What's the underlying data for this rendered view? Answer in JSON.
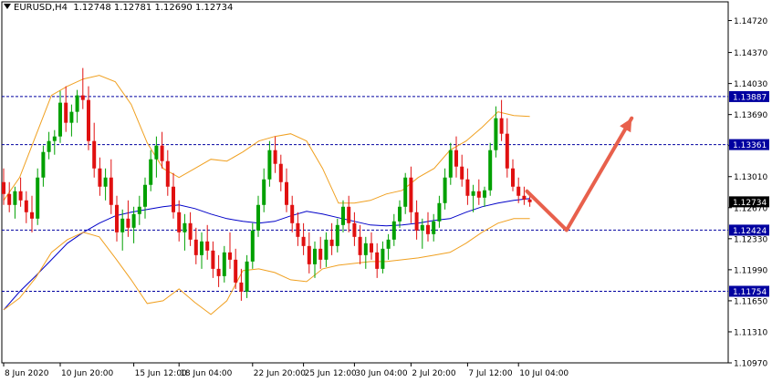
{
  "header": {
    "symbol": "EURUSD,H4",
    "ohlc": "1.12748 1.12781 1.12690 1.12734"
  },
  "chart_data": {
    "type": "candlestick",
    "ylim": [
      1.1097,
      1.14925
    ],
    "y_ticks": [
      "1.14720",
      "1.14370",
      "1.14030",
      "1.13690",
      "1.13350",
      "1.13010",
      "1.12670",
      "1.12330",
      "1.11990",
      "1.11650",
      "1.11310",
      "1.10970"
    ],
    "x_ticks": [
      "8 Jun 2020",
      "10 Jun 20:00",
      "15 Jun 12:00",
      "18 Jun 04:00",
      "22 Jun 20:00",
      "25 Jun 12:00",
      "30 Jun 04:00",
      "2 Jul 20:00",
      "7 Jul 12:00",
      "10 Jul 04:00"
    ],
    "levels": [
      {
        "value": 1.13887,
        "label": "1.13887"
      },
      {
        "value": 1.13361,
        "label": "1.13361"
      },
      {
        "value": 1.12424,
        "label": "1.12424"
      },
      {
        "value": 1.11754,
        "label": "1.11754"
      }
    ],
    "current_price": {
      "value": 1.12734,
      "label": "1.12734"
    },
    "series": [
      {
        "indicator": "moving-average",
        "values": [
          1.1155,
          1.1175,
          1.1192,
          1.121,
          1.1228,
          1.124,
          1.125,
          1.1258,
          1.1262,
          1.1265,
          1.1268,
          1.127,
          1.1266,
          1.126,
          1.1255,
          1.1252,
          1.125,
          1.1252,
          1.1258,
          1.1263,
          1.126,
          1.1256,
          1.1252,
          1.1248,
          1.1247,
          1.1248,
          1.125,
          1.1253,
          1.1255,
          1.1262,
          1.1268,
          1.1272,
          1.1275,
          1.1277
        ]
      },
      {
        "indicator": "bollinger-upper",
        "values": [
          1.1275,
          1.13,
          1.1345,
          1.139,
          1.14,
          1.1408,
          1.1412,
          1.1405,
          1.138,
          1.1338,
          1.131,
          1.13,
          1.131,
          1.132,
          1.1318,
          1.1328,
          1.134,
          1.1345,
          1.1348,
          1.134,
          1.131,
          1.1272,
          1.1272,
          1.1275,
          1.1282,
          1.1286,
          1.13,
          1.131,
          1.133,
          1.134,
          1.1355,
          1.1372,
          1.1368,
          1.1367
        ]
      },
      {
        "indicator": "bollinger-lower",
        "values": [
          1.1155,
          1.1168,
          1.119,
          1.1218,
          1.1232,
          1.124,
          1.1235,
          1.1212,
          1.1188,
          1.1162,
          1.1165,
          1.1178,
          1.1163,
          1.115,
          1.1165,
          1.1198,
          1.12,
          1.1196,
          1.1188,
          1.1186,
          1.12,
          1.1204,
          1.1206,
          1.1208,
          1.1208,
          1.121,
          1.1212,
          1.1215,
          1.1218,
          1.1228,
          1.124,
          1.125,
          1.1255,
          1.1255
        ]
      },
      {
        "name": "EURUSD,H4",
        "ohlc": [
          [
            1.1295,
            1.131,
            1.127,
            1.1282
          ],
          [
            1.1282,
            1.1295,
            1.1262,
            1.127
          ],
          [
            1.127,
            1.129,
            1.1255,
            1.1285
          ],
          [
            1.1285,
            1.13,
            1.1268,
            1.1275
          ],
          [
            1.1275,
            1.1285,
            1.125,
            1.1262
          ],
          [
            1.1262,
            1.128,
            1.124,
            1.1255
          ],
          [
            1.1255,
            1.131,
            1.1248,
            1.13
          ],
          [
            1.13,
            1.1335,
            1.129,
            1.1328
          ],
          [
            1.1328,
            1.135,
            1.132,
            1.134
          ],
          [
            1.134,
            1.1352,
            1.1325,
            1.1345
          ],
          [
            1.1345,
            1.1395,
            1.1338,
            1.1382
          ],
          [
            1.1382,
            1.14,
            1.135,
            1.136
          ],
          [
            1.136,
            1.138,
            1.1345,
            1.1372
          ],
          [
            1.1372,
            1.1396,
            1.136,
            1.139
          ],
          [
            1.139,
            1.142,
            1.1375,
            1.1385
          ],
          [
            1.1385,
            1.14,
            1.133,
            1.134
          ],
          [
            1.134,
            1.136,
            1.13,
            1.131
          ],
          [
            1.131,
            1.1322,
            1.128,
            1.129
          ],
          [
            1.129,
            1.131,
            1.1275,
            1.13
          ],
          [
            1.13,
            1.132,
            1.126,
            1.127
          ],
          [
            1.127,
            1.128,
            1.123,
            1.124
          ],
          [
            1.124,
            1.1265,
            1.122,
            1.1255
          ],
          [
            1.1255,
            1.1275,
            1.1235,
            1.1245
          ],
          [
            1.1245,
            1.1268,
            1.1228,
            1.126
          ],
          [
            1.126,
            1.128,
            1.1248,
            1.1268
          ],
          [
            1.1268,
            1.13,
            1.1255,
            1.1292
          ],
          [
            1.1292,
            1.133,
            1.1285,
            1.132
          ],
          [
            1.132,
            1.1345,
            1.13,
            1.1335
          ],
          [
            1.1335,
            1.135,
            1.131,
            1.1318
          ],
          [
            1.1318,
            1.133,
            1.128,
            1.129
          ],
          [
            1.129,
            1.1305,
            1.1255,
            1.1262
          ],
          [
            1.1262,
            1.1275,
            1.123,
            1.124
          ],
          [
            1.124,
            1.126,
            1.122,
            1.125
          ],
          [
            1.125,
            1.1262,
            1.1225,
            1.1232
          ],
          [
            1.1232,
            1.1245,
            1.1205,
            1.1215
          ],
          [
            1.1215,
            1.124,
            1.12,
            1.123
          ],
          [
            1.123,
            1.1248,
            1.121,
            1.122
          ],
          [
            1.122,
            1.123,
            1.119,
            1.12
          ],
          [
            1.12,
            1.1215,
            1.118,
            1.1192
          ],
          [
            1.1192,
            1.1225,
            1.1185,
            1.1218
          ],
          [
            1.1218,
            1.124,
            1.12,
            1.121
          ],
          [
            1.121,
            1.1222,
            1.1178,
            1.1185
          ],
          [
            1.1185,
            1.12,
            1.1165,
            1.1175
          ],
          [
            1.1175,
            1.1215,
            1.1168,
            1.1208
          ],
          [
            1.1208,
            1.125,
            1.12,
            1.1242
          ],
          [
            1.1242,
            1.128,
            1.1235,
            1.127
          ],
          [
            1.127,
            1.131,
            1.1262,
            1.1298
          ],
          [
            1.1298,
            1.134,
            1.129,
            1.133
          ],
          [
            1.133,
            1.1345,
            1.1305,
            1.1315
          ],
          [
            1.1315,
            1.1325,
            1.1285,
            1.1295
          ],
          [
            1.1295,
            1.131,
            1.1262,
            1.127
          ],
          [
            1.127,
            1.128,
            1.124,
            1.125
          ],
          [
            1.125,
            1.1262,
            1.1225,
            1.1235
          ],
          [
            1.1235,
            1.125,
            1.1215,
            1.1225
          ],
          [
            1.1225,
            1.124,
            1.1195,
            1.1205
          ],
          [
            1.1205,
            1.123,
            1.119,
            1.1222
          ],
          [
            1.1222,
            1.1235,
            1.12,
            1.121
          ],
          [
            1.121,
            1.124,
            1.1202,
            1.1232
          ],
          [
            1.1232,
            1.125,
            1.1215,
            1.1225
          ],
          [
            1.1225,
            1.1255,
            1.1218,
            1.1248
          ],
          [
            1.1248,
            1.1275,
            1.124,
            1.1268
          ],
          [
            1.1268,
            1.128,
            1.124,
            1.125
          ],
          [
            1.125,
            1.1262,
            1.1225,
            1.1235
          ],
          [
            1.1235,
            1.1248,
            1.1205,
            1.1215
          ],
          [
            1.1215,
            1.1235,
            1.12,
            1.1228
          ],
          [
            1.1228,
            1.124,
            1.121,
            1.1218
          ],
          [
            1.1218,
            1.1228,
            1.119,
            1.12
          ],
          [
            1.12,
            1.123,
            1.1195,
            1.1222
          ],
          [
            1.1222,
            1.1238,
            1.121,
            1.1232
          ],
          [
            1.1232,
            1.126,
            1.1225,
            1.1252
          ],
          [
            1.1252,
            1.1275,
            1.1245,
            1.1268
          ],
          [
            1.1268,
            1.1305,
            1.126,
            1.13
          ],
          [
            1.13,
            1.1312,
            1.125,
            1.1262
          ],
          [
            1.1262,
            1.1275,
            1.1232,
            1.1242
          ],
          [
            1.1242,
            1.1255,
            1.1222,
            1.1248
          ],
          [
            1.1248,
            1.1262,
            1.123,
            1.1238
          ],
          [
            1.1238,
            1.126,
            1.123,
            1.1252
          ],
          [
            1.1252,
            1.128,
            1.1245,
            1.1272
          ],
          [
            1.1272,
            1.131,
            1.1265,
            1.13
          ],
          [
            1.13,
            1.1338,
            1.1292,
            1.133
          ],
          [
            1.133,
            1.1345,
            1.13,
            1.1312
          ],
          [
            1.1312,
            1.1325,
            1.129,
            1.1298
          ],
          [
            1.1298,
            1.131,
            1.127,
            1.128
          ],
          [
            1.128,
            1.1292,
            1.1262,
            1.1285
          ],
          [
            1.1285,
            1.1298,
            1.127,
            1.1278
          ],
          [
            1.1278,
            1.129,
            1.1268,
            1.1286
          ],
          [
            1.1286,
            1.1338,
            1.128,
            1.133
          ],
          [
            1.133,
            1.1378,
            1.1322,
            1.1365
          ],
          [
            1.1365,
            1.1385,
            1.134,
            1.1348
          ],
          [
            1.1348,
            1.1365,
            1.13,
            1.131
          ],
          [
            1.131,
            1.132,
            1.1285,
            1.129
          ],
          [
            1.129,
            1.13,
            1.1272,
            1.128
          ],
          [
            1.128,
            1.129,
            1.127,
            1.1276
          ],
          [
            1.1276,
            1.1282,
            1.1268,
            1.1273
          ]
        ]
      }
    ],
    "annotation": {
      "type": "arrow-path",
      "points": [
        [
          92.5,
          1.1285
        ],
        [
          99.5,
          1.12424
        ],
        [
          111,
          1.1365
        ]
      ],
      "color": "#e8604c"
    },
    "colors": {
      "bull": "#00a000",
      "bear": "#e01010",
      "ma": "#0000c8",
      "bands": "#f0a020",
      "levels": "#0000a0"
    }
  }
}
